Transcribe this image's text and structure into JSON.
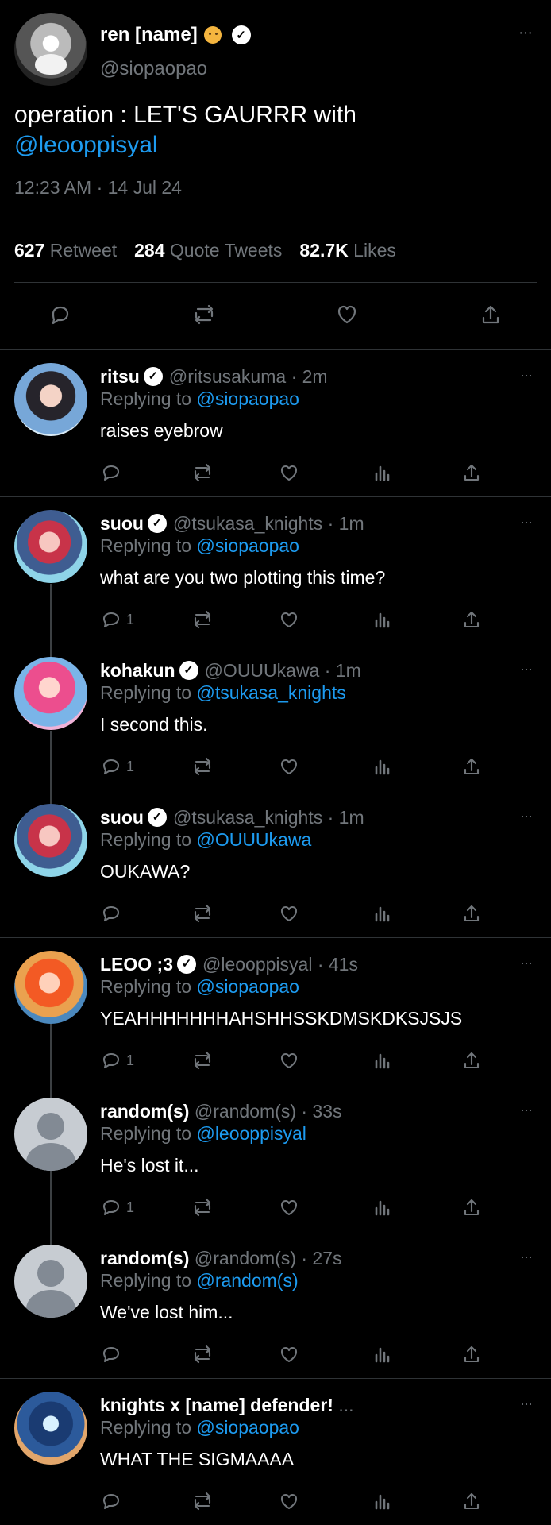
{
  "main": {
    "author": "ren [name]",
    "handle": "@siopaopao",
    "text_prefix": "operation : LET'S GAURRR with",
    "text_mention": "@leooppisyal",
    "timestamp": "12:23 AM · 14 Jul 24",
    "stats": [
      {
        "value": "627",
        "label": "Retweet"
      },
      {
        "value": "284",
        "label": "Quote Tweets"
      },
      {
        "value": "82.7K",
        "label": "Likes"
      }
    ],
    "more": "···"
  },
  "replies": [
    {
      "name": "ritsu",
      "handle": "@ritsusakuma · 2m",
      "reply_label": "Replying to",
      "reply_to": "@siopaopao",
      "text": "raises eyebrow",
      "reply_count": ""
    },
    {
      "name": "suou",
      "handle": "@tsukasa_knights · 1m",
      "reply_label": "Replying to",
      "reply_to": "@siopaopao",
      "text": "what are you two plotting this time?",
      "reply_count": "1"
    },
    {
      "name": "kohakun",
      "handle": "@OUUUkawa · 1m",
      "reply_label": "Replying to",
      "reply_to": "@tsukasa_knights",
      "text": "I second this.",
      "reply_count": "1"
    },
    {
      "name": "suou",
      "handle": "@tsukasa_knights · 1m",
      "reply_label": "Replying to",
      "reply_to": "@OUUUkawa",
      "text": "OUKAWA?",
      "reply_count": ""
    },
    {
      "name": "LEOO ;3",
      "handle": "@leooppisyal · 41s",
      "reply_label": "Replying to",
      "reply_to": "@siopaopao",
      "text": "YEAHHHHHHHAHSHHSSKDMSKDKSJSJS",
      "reply_count": "1"
    },
    {
      "name": "random(s)",
      "handle": "@random(s) · 33s",
      "reply_label": "Replying to",
      "reply_to": "@leooppisyal",
      "text": "He's lost it...",
      "reply_count": "1"
    },
    {
      "name": "random(s)",
      "handle": "@random(s) · 27s",
      "reply_label": "Replying to",
      "reply_to": "@random(s)",
      "text": "We've lost him...",
      "reply_count": ""
    },
    {
      "name": "knights x [name] defender!",
      "handle": "...",
      "reply_label": "Replying to",
      "reply_to": "@siopaopao",
      "text": "WHAT THE SIGMAAAA",
      "reply_count": ""
    }
  ]
}
